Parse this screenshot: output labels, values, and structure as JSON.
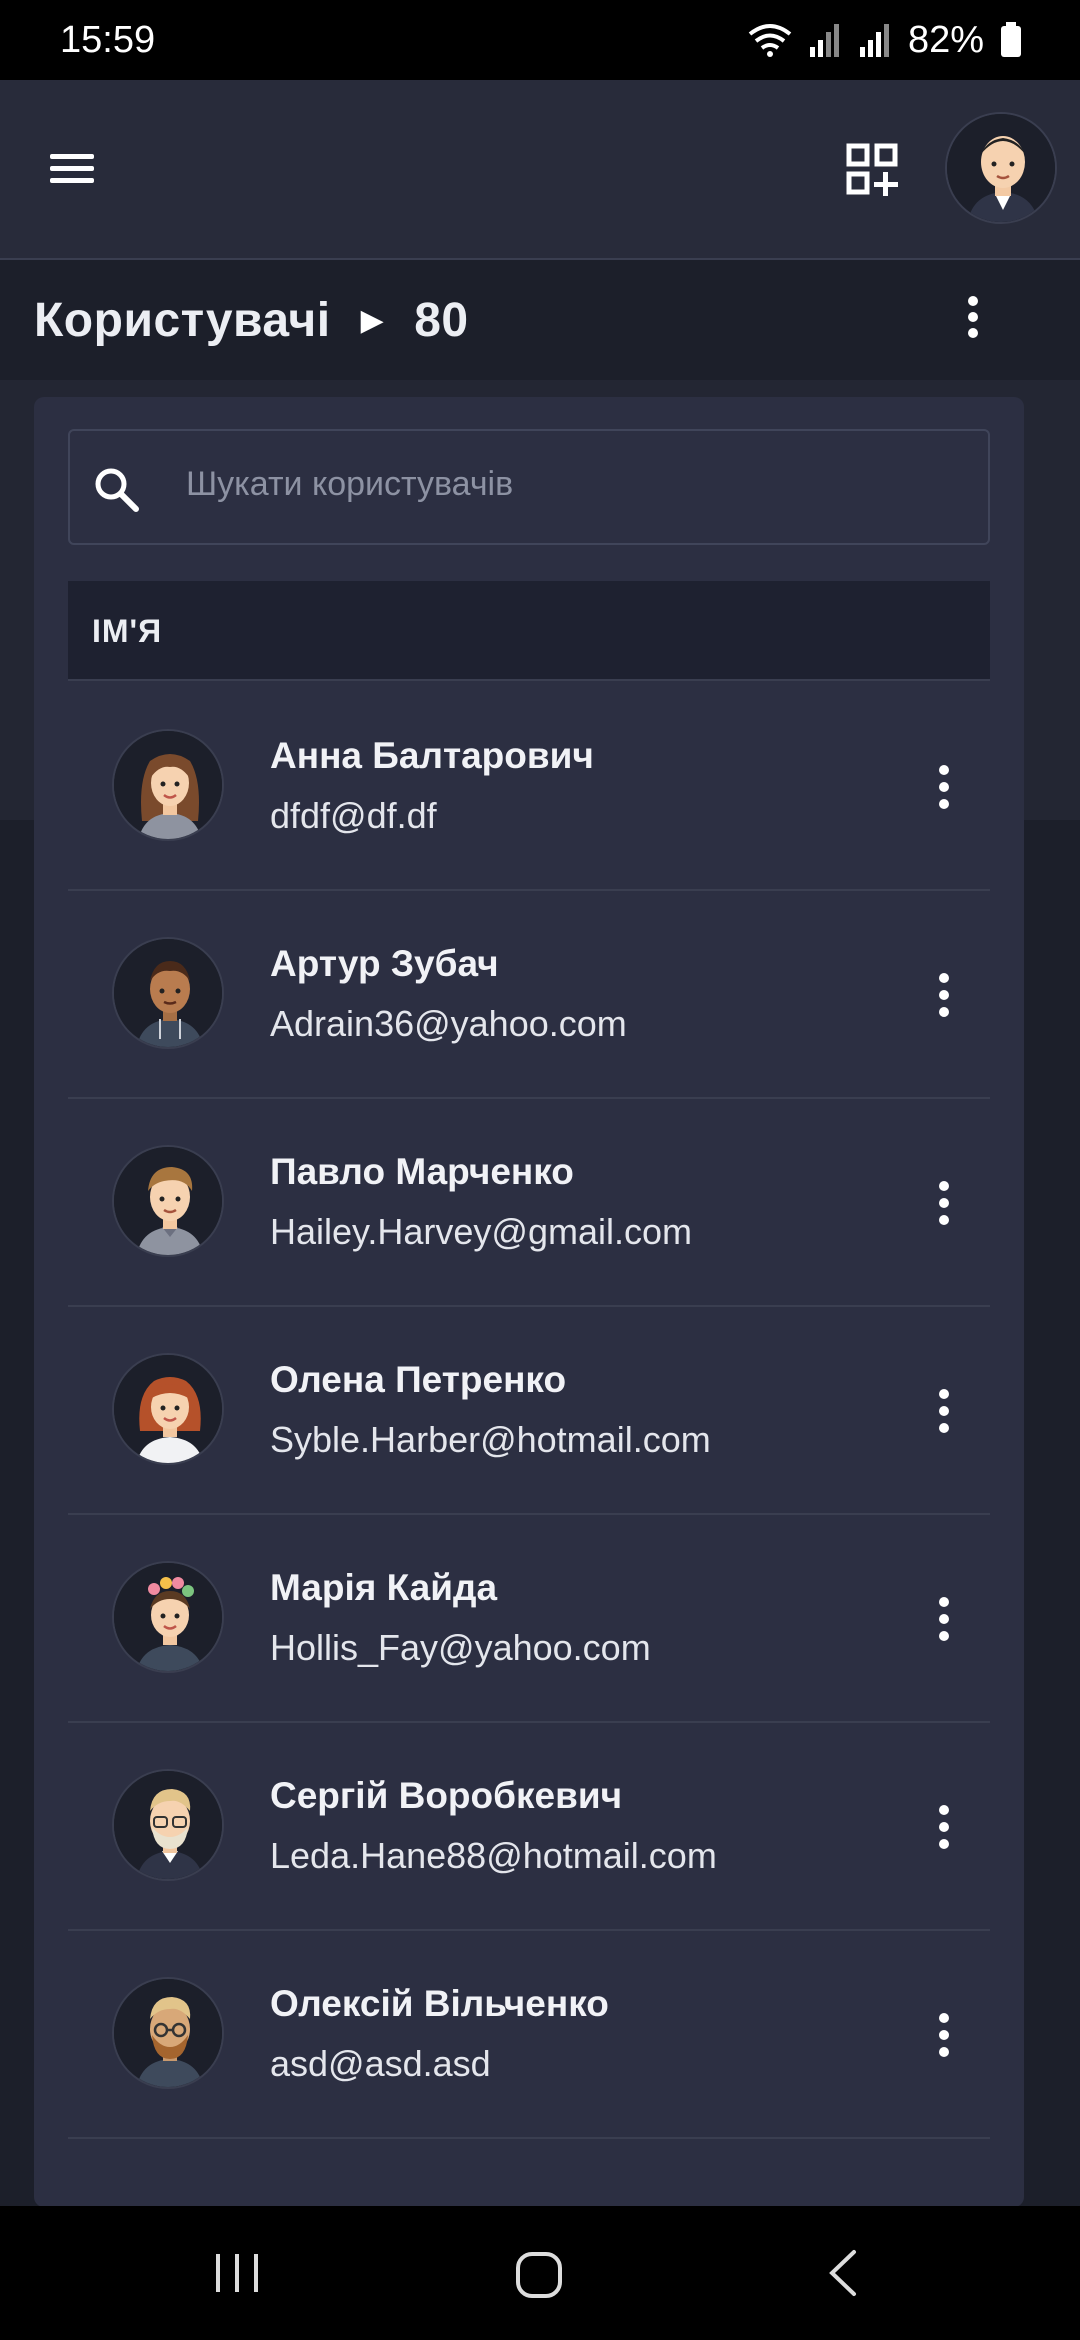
{
  "status_bar": {
    "time": "15:59",
    "battery": "82%"
  },
  "app_bar": {
    "menu_icon": "hamburger-icon",
    "qr_icon": "qr-add-icon",
    "avatar": "profile-avatar"
  },
  "header": {
    "title": "Користувачі",
    "count": "80",
    "menu_icon": "more-vertical-icon"
  },
  "search": {
    "placeholder": "Шукати користувачів",
    "icon": "search-icon"
  },
  "table": {
    "column_name": "ІМ'Я",
    "rows": [
      {
        "name": "Анна Балтарович",
        "email": "dfdf@df.df",
        "avatar": "female-long-brown-hair"
      },
      {
        "name": "Артур Зубач",
        "email": "Adrain36@yahoo.com",
        "avatar": "male-dark-skin"
      },
      {
        "name": "Павло Марченко",
        "email": "Hailey.Harvey@gmail.com",
        "avatar": "male-light-hair"
      },
      {
        "name": "Олена Петренко",
        "email": "Syble.Harber@hotmail.com",
        "avatar": "female-red-hair"
      },
      {
        "name": "Марія Кайда",
        "email": "Hollis_Fay@yahoo.com",
        "avatar": "female-flower-crown"
      },
      {
        "name": "Сергій Воробкевич",
        "email": "Leda.Hane88@hotmail.com",
        "avatar": "male-beard-glasses"
      },
      {
        "name": "Олексій Вільченко",
        "email": "asd@asd.asd",
        "avatar": "male-glasses-beard"
      }
    ]
  },
  "colors": {
    "background": "#1c1f2a",
    "card": "#2c2f42",
    "appbar": "#282b3a"
  }
}
